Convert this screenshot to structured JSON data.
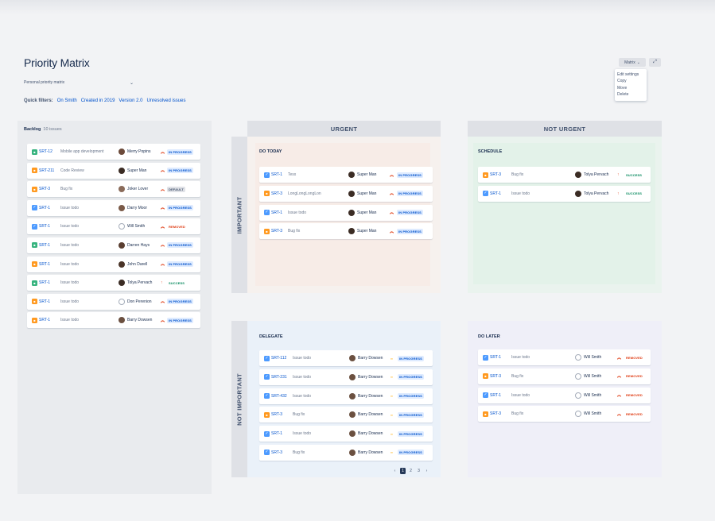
{
  "header": {
    "title": "Priority Matrix",
    "board_select": "Personal priority matrix",
    "quick_filters_label": "Quick filters:",
    "quick_filters": [
      "On Smith",
      "Created in 2019",
      "Version 2.0",
      "Unresolved issues"
    ]
  },
  "toolbar": {
    "view_label": "Matrix",
    "menu": [
      "Edit settings",
      "Copy",
      "Move",
      "Delete"
    ]
  },
  "colors": {
    "story": "#36b37e",
    "task": "#4c9aff",
    "bug": "#ff991f",
    "in_progress_bg": "#deebff",
    "in_progress_fg": "#0052cc",
    "removed_fg": "#de350b",
    "success_fg": "#00875a",
    "default_bg": "#dfe1e6",
    "default_fg": "#42526e",
    "prio_high": "#de350b",
    "prio_medium": "#ffab00"
  },
  "backlog": {
    "title": "Backlog",
    "count": "10 issues",
    "items": [
      {
        "type": "story",
        "key": "SRT-12",
        "summary": "Mobile app development",
        "assignee": "Merry Popins",
        "avatar": "#6b4a3a",
        "prio": "high",
        "status": "IN PROGRESS"
      },
      {
        "type": "bug",
        "key": "SRT-211",
        "summary": "Code Review",
        "assignee": "Super Man",
        "avatar": "#3b2c24",
        "prio": "high",
        "status": "IN PROGRESS"
      },
      {
        "type": "bug",
        "key": "SRT-3",
        "summary": "Bug fix",
        "assignee": "Joker Lover",
        "avatar": "#8a6b5a",
        "prio": "high",
        "status": "DEFAULT"
      },
      {
        "type": "task",
        "key": "SRT-1",
        "summary": "Issue todo",
        "assignee": "Darry Moor",
        "avatar": "#7a5a48",
        "prio": "high",
        "status": "IN PROGRESS"
      },
      {
        "type": "task",
        "key": "SRT-1",
        "summary": "Issue todo",
        "assignee": "Will Smith",
        "avatar": "empty",
        "prio": "high",
        "status": "REMOVED"
      },
      {
        "type": "story",
        "key": "SRT-1",
        "summary": "Issue todo",
        "assignee": "Darren Hays",
        "avatar": "#5a3e30",
        "prio": "high",
        "status": "IN PROGRESS"
      },
      {
        "type": "bug",
        "key": "SRT-1",
        "summary": "Issue todo",
        "assignee": "John Darell",
        "avatar": "#4a3428",
        "prio": "high",
        "status": "IN PROGRESS"
      },
      {
        "type": "story",
        "key": "SRT-1",
        "summary": "Issue todo",
        "assignee": "Tolya Pervach",
        "avatar": "#3b2c24",
        "prio": "high",
        "status": "SUCCESS"
      },
      {
        "type": "bug",
        "key": "SRT-1",
        "summary": "Issue todo",
        "assignee": "Don Perenion",
        "avatar": "empty",
        "prio": "high",
        "status": "IN PROGRESS"
      },
      {
        "type": "bug",
        "key": "SRT-1",
        "summary": "Issue todo",
        "assignee": "Barry Dowsen",
        "avatar": "#6b5040",
        "prio": "high",
        "status": "IN PROGRESS"
      }
    ]
  },
  "matrix": {
    "col_urgent": "URGENT",
    "col_not_urgent": "NOT URGENT",
    "row_important": "IMPORTANT",
    "row_not_important": "NOT IMPORTANT",
    "do_today": {
      "title": "DO TODAY",
      "items": [
        {
          "type": "task",
          "key": "SRT-1",
          "summary": "Tesx",
          "assignee": "Super Man",
          "avatar": "#3b2c24",
          "prio": "high",
          "status": "IN PROGRESS"
        },
        {
          "type": "bug",
          "key": "SRT-3",
          "summary": "LongLongLongLon",
          "assignee": "Super Man",
          "avatar": "#3b2c24",
          "prio": "high",
          "status": "IN PROGRESS"
        },
        {
          "type": "task",
          "key": "SRT-1",
          "summary": "Issue todo",
          "assignee": "Super Man",
          "avatar": "#3b2c24",
          "prio": "high",
          "status": "IN PROGRESS"
        },
        {
          "type": "bug",
          "key": "SRT-3",
          "summary": "Bug fix",
          "assignee": "Super Man",
          "avatar": "#3b2c24",
          "prio": "high",
          "status": "IN PROGRESS"
        }
      ]
    },
    "schedule": {
      "title": "SCHEDULE",
      "items": [
        {
          "type": "bug",
          "key": "SRT-3",
          "summary": "Bug fix",
          "assignee": "Tolya Pervach",
          "avatar": "#3b2c24",
          "prio": "high",
          "status": "SUCCESS"
        },
        {
          "type": "task",
          "key": "SRT-1",
          "summary": "Issue todo",
          "assignee": "Tolya Pervach",
          "avatar": "#3b2c24",
          "prio": "high",
          "status": "SUCCESS"
        }
      ]
    },
    "delegate": {
      "title": "DELEGATE",
      "items": [
        {
          "type": "task",
          "key": "SRT-112",
          "summary": "Issue todo",
          "assignee": "Barry Dowsen",
          "avatar": "#6b5040",
          "prio": "medium",
          "status": "IN PROGRESS"
        },
        {
          "type": "task",
          "key": "SRT-231",
          "summary": "Issue todo",
          "assignee": "Barry Dowsen",
          "avatar": "#6b5040",
          "prio": "medium",
          "status": "IN PROGRESS"
        },
        {
          "type": "task",
          "key": "SRT-432",
          "summary": "Issue todo",
          "assignee": "Barry Dowsen",
          "avatar": "#6b5040",
          "prio": "medium",
          "status": "IN PROGRESS"
        },
        {
          "type": "bug",
          "key": "SRT-3",
          "summary": "Bug fix",
          "assignee": "Barry Dowsen",
          "avatar": "#6b5040",
          "prio": "medium",
          "status": "IN PROGRESS"
        },
        {
          "type": "task",
          "key": "SRT-1",
          "summary": "Issue todo",
          "assignee": "Barry Dowsen",
          "avatar": "#6b5040",
          "prio": "medium",
          "status": "IN PROGRESS"
        },
        {
          "type": "task",
          "key": "SRT-3",
          "summary": "Bug fix",
          "assignee": "Barry Dowsen",
          "avatar": "#6b5040",
          "prio": "medium",
          "status": "IN PROGRESS"
        }
      ],
      "pages": [
        "1",
        "2",
        "3"
      ],
      "current_page": "1"
    },
    "do_later": {
      "title": "DO LATER",
      "items": [
        {
          "type": "task",
          "key": "SRT-1",
          "summary": "Issue todo",
          "assignee": "Will Smith",
          "avatar": "empty",
          "prio": "high",
          "status": "REMOVED"
        },
        {
          "type": "bug",
          "key": "SRT-3",
          "summary": "Bug fix",
          "assignee": "Will Smith",
          "avatar": "empty",
          "prio": "high",
          "status": "REMOVED"
        },
        {
          "type": "task",
          "key": "SRT-1",
          "summary": "Issue todo",
          "assignee": "Will Smith",
          "avatar": "empty",
          "prio": "high",
          "status": "REMOVED"
        },
        {
          "type": "bug",
          "key": "SRT-3",
          "summary": "Bug fix",
          "assignee": "Will Smith",
          "avatar": "empty",
          "prio": "high",
          "status": "REMOVED"
        }
      ]
    }
  }
}
